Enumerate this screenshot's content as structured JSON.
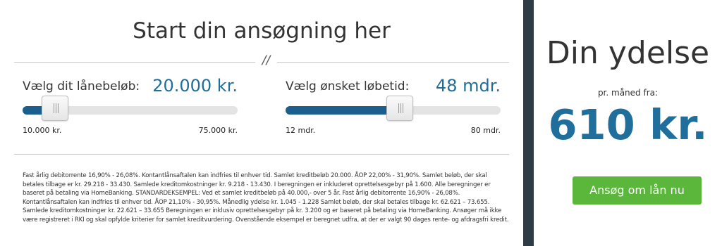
{
  "form": {
    "title": "Start din ansøgning her",
    "divider_text": "//",
    "amount": {
      "label": "Vælg dit lånebeløb:",
      "value": "20.000 kr.",
      "min_label": "10.000 kr.",
      "max_label": "75.000 kr.",
      "fill_fraction": 0.15
    },
    "term": {
      "label": "Vælg ønsket løbetid:",
      "value": "48 mdr.",
      "min_label": "12 mdr.",
      "max_label": "80 mdr.",
      "fill_fraction": 0.53
    },
    "disclaimer": "Fast årlig debitorrente 16,90% - 26,08%. Kontantlånsaftalen kan indfries til enhver tid. Samlet kreditbeløb 20.000. ÅOP 22,00% - 31,90%. Samlet beløb, der skal betales tilbage er kr. 29.218 - 33.430. Samlede kreditomkostninger kr. 9.218 - 13.430. I beregningen er inkluderet oprettelsesgebyr på 1.600. Alle beregninger er baseret på betaling via HomeBanking. STANDARDEKSEMPEL: Ved et samlet kreditbeløb på 40.000,- over 5 år. Fast årlig debitorrente 16,90% - 26,08%. Kontantlånsaftalen kan indfries til enhver tid. ÅOP 21,10% - 30,95%. Månedlig ydelse kr. 1.045 - 1.228 Samlet beløb, der skal betales tilbage kr. 62.621 – 73.655. Samlede kreditomkostninger kr. 22.621 – 33.655 Beregningen er inklusiv oprettelsesgebyr på kr. 3.200 og er baseret på betaling via HomeBanking. Ansøger må ikke være registreret i RKI og skal opfylde kriterier for samlet kreditvurdering. Ovenstående eksempel er beregnet udfra, at der er valgt 90 dages rente- og afdragsfri kredit."
  },
  "summary": {
    "title": "Din ydelse",
    "subtitle": "pr. måned fra:",
    "amount": "610 kr.",
    "button_label": "Ansøg om lån nu"
  },
  "colors": {
    "accent": "#1f6e9c",
    "slider_fill": "#1a5f8e",
    "button": "#5ab73c",
    "divider": "#2e3c46"
  }
}
